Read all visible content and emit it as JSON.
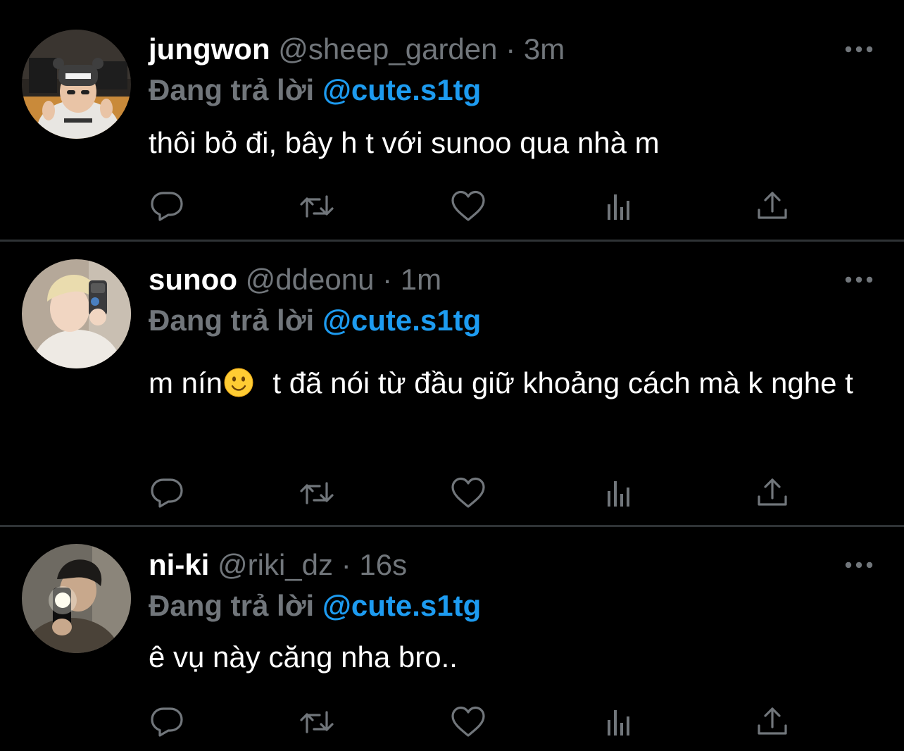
{
  "theme": {
    "background": "#000000",
    "divider": "#2f3336",
    "muted": "#71767b",
    "accent": "#1d9bf0",
    "text": "#ffffff"
  },
  "tweets": [
    {
      "name": "jungwon",
      "handle": "@sheep_garden",
      "separator": "·",
      "time": "3m",
      "reply_label": "Đang trả lời",
      "reply_mention": "@cute.s1tg",
      "text_before_emoji": "thôi bỏ đi, bây h t với sunoo qua nhà m",
      "text_after_emoji": "",
      "has_emoji": false
    },
    {
      "name": "sunoo",
      "handle": "@ddeonu",
      "separator": "·",
      "time": "1m",
      "reply_label": "Đang trả lời",
      "reply_mention": "@cute.s1tg",
      "text_before_emoji": "m nín",
      "text_after_emoji": "  t đã nói từ đầu giữ khoảng cách mà k nghe t",
      "has_emoji": true,
      "emoji": "slightly-smiling-face-icon"
    },
    {
      "name": "ni-ki",
      "handle": "@riki_dz",
      "separator": "·",
      "time": "16s",
      "reply_label": "Đang trả lời",
      "reply_mention": "@cute.s1tg",
      "text_before_emoji": "ê vụ này căng nha bro..",
      "text_after_emoji": "",
      "has_emoji": false
    }
  ],
  "icons": {
    "reply": "comment-bubble-icon",
    "retweet": "retweet-icon",
    "like": "heart-icon",
    "views": "analytics-bars-icon",
    "share": "share-upload-icon",
    "more": "more-dots-icon"
  }
}
